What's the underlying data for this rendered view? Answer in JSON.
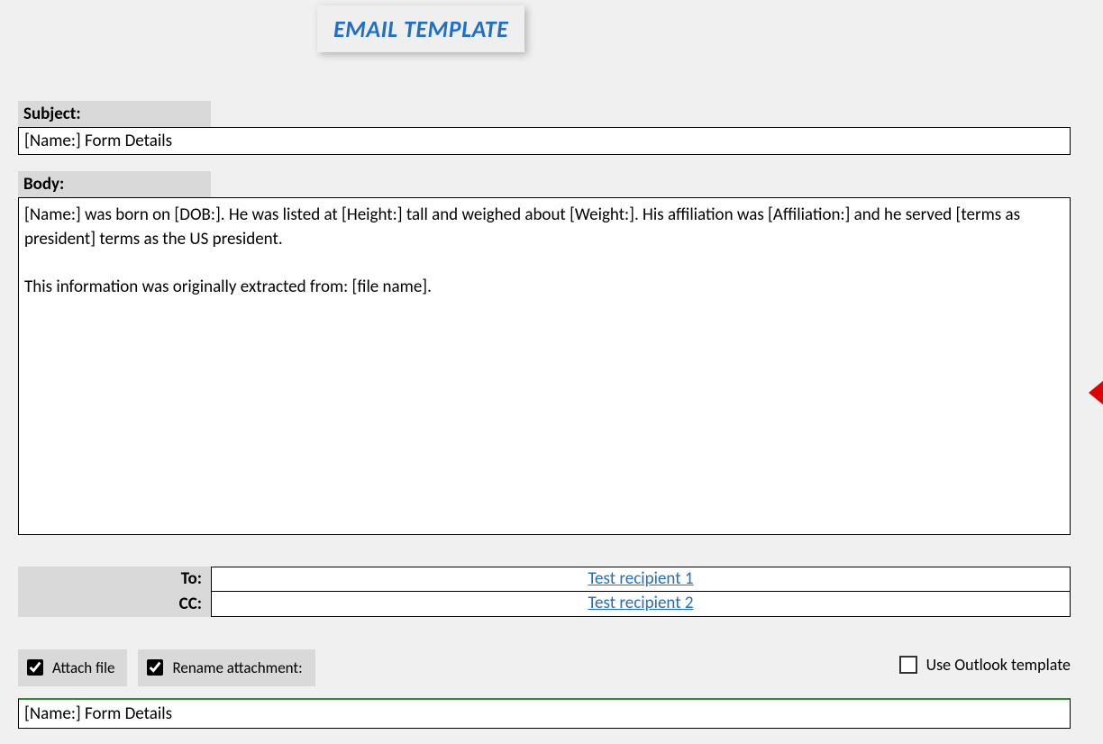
{
  "title": "EMAIL TEMPLATE",
  "subject": {
    "label": "Subject:",
    "value": "[Name:] Form Details"
  },
  "body": {
    "label": "Body:",
    "value": "[Name:] was born on [DOB:]. He was listed at [Height:] tall and weighed about [Weight:]. His affiliation was [Affiliation:] and he served [terms as president] terms as the US president.\n\nThis information was originally extracted from: [file name]."
  },
  "recipients": {
    "to_label": "To:",
    "to_value": "Test recipient 1",
    "cc_label": "CC:",
    "cc_value": "Test recipient 2"
  },
  "options": {
    "attach_label": "Attach file",
    "attach_checked": true,
    "rename_label": "Rename attachment:",
    "rename_checked": true,
    "outlook_label": "Use Outlook template",
    "outlook_checked": false
  },
  "rename_value": "[Name:] Form Details"
}
